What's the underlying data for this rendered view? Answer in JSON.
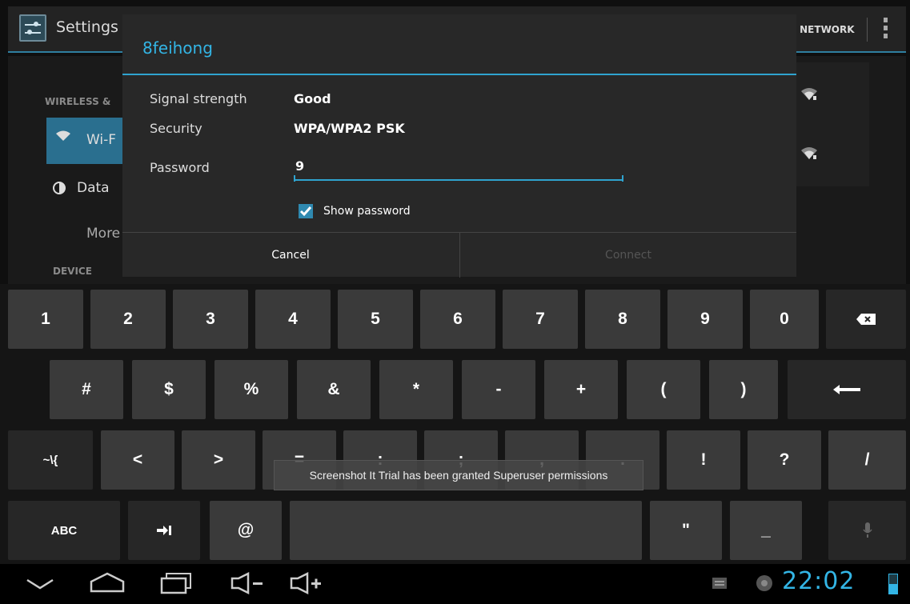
{
  "settings": {
    "title": "Settings",
    "add_network_label": "D NETWORK",
    "section_wireless": "WIRELESS &",
    "item_wifi": "Wi-F",
    "item_data": "Data",
    "item_more": "More",
    "section_device": "DEVICE"
  },
  "dialog": {
    "title": "8feihong",
    "signal_label": "Signal strength",
    "signal_value": "Good",
    "security_label": "Security",
    "security_value": "WPA/WPA2 PSK",
    "password_label": "Password",
    "password_value": "9",
    "show_password_label": "Show password",
    "show_password_checked": true,
    "cancel_label": "Cancel",
    "connect_label": "Connect"
  },
  "keyboard": {
    "row1": [
      "1",
      "2",
      "3",
      "4",
      "5",
      "6",
      "7",
      "8",
      "9",
      "0"
    ],
    "row2": [
      "#",
      "$",
      "%",
      "&",
      "*",
      "-",
      "+",
      "(",
      ")"
    ],
    "row3": [
      "~\\{",
      "<",
      ">",
      "=",
      ":",
      ";",
      ",",
      ".",
      "!",
      "?",
      "/"
    ],
    "row4": {
      "abc": "ABC",
      "at": "@",
      "quote": "\"",
      "underscore": "_"
    },
    "icons": [
      "backspace-icon",
      "enter-icon",
      "tab-icon",
      "mic-icon"
    ]
  },
  "toast": "Screenshot It Trial has been granted Superuser permissions",
  "system_bar": {
    "clock": "22:02",
    "icons": [
      "back-icon",
      "home-icon",
      "recent-apps-icon",
      "volume-down-icon",
      "volume-up-icon",
      "keyboard-icon",
      "notification-icon",
      "battery-icon"
    ]
  },
  "colors": {
    "accent": "#33b5e5",
    "divider": "#2fa3cf",
    "dialog_bg": "#282828",
    "key_bg": "#3a3a3a"
  }
}
